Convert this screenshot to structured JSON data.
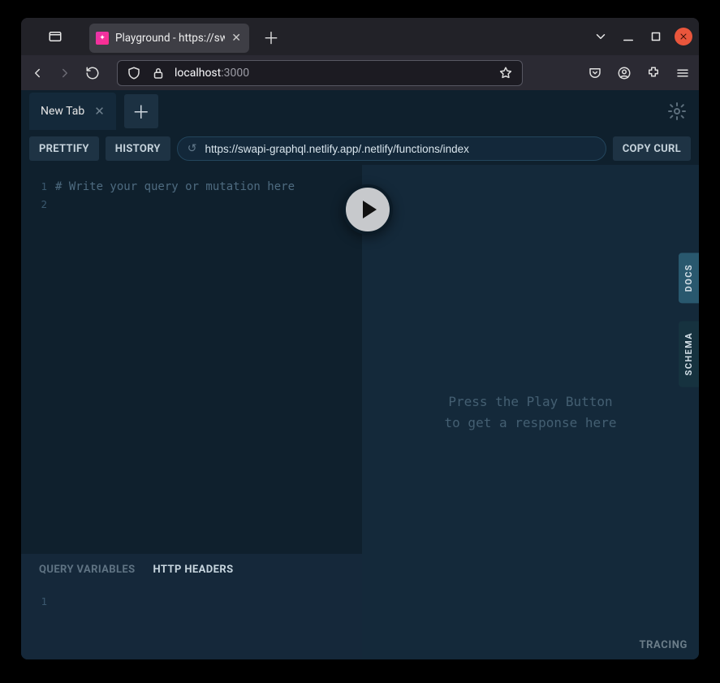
{
  "browser": {
    "tab_title": "Playground - https://swa",
    "url_host": "localhost",
    "url_port": ":3000"
  },
  "playground": {
    "tabs": {
      "current": "New Tab"
    },
    "toolbar": {
      "prettify": "PRETTIFY",
      "history": "HISTORY",
      "copy_curl": "COPY CURL",
      "endpoint": "https://swapi-graphql.netlify.app/.netlify/functions/index"
    },
    "editor": {
      "lines": [
        "1",
        "2"
      ],
      "placeholder": "# Write your query or mutation here"
    },
    "bottom": {
      "query_vars": "QUERY VARIABLES",
      "http_headers": "HTTP HEADERS",
      "lines": [
        "1"
      ]
    },
    "result": {
      "hint_line1": "Press the Play Button",
      "hint_line2": "to get a response here"
    },
    "side": {
      "docs": "DOCS",
      "schema": "SCHEMA"
    },
    "tracing": "TRACING"
  }
}
